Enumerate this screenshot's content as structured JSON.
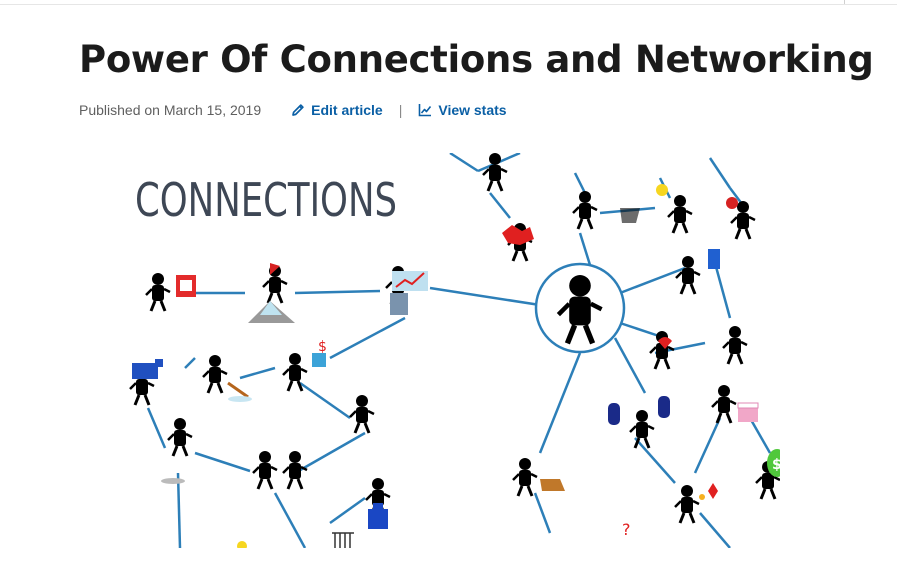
{
  "article": {
    "title": "Power Of Connections and Networking",
    "published": "Published on March 15, 2019",
    "actions": {
      "edit_label": "Edit article",
      "stats_label": "View stats",
      "separator": "|"
    },
    "hero_image": {
      "heading": "CONNECTIONS",
      "heading_color": "#3e4755",
      "line_color": "#2d7fb8"
    }
  },
  "colors": {
    "link": "#0a5fa5",
    "title": "#1b1b1b",
    "meta": "#5f5f5f"
  },
  "icons": {
    "edit": "pencil-icon",
    "stats": "line-chart-icon"
  }
}
